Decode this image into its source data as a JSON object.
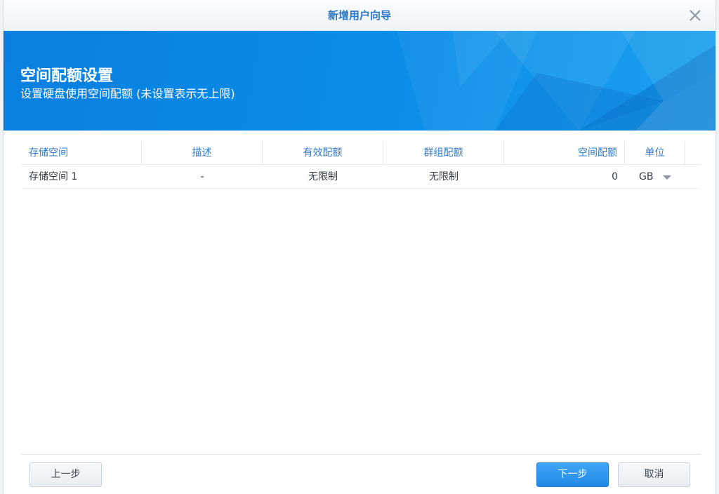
{
  "dialog": {
    "title": "新增用户向导"
  },
  "banner": {
    "title": "空间配额设置",
    "subtitle": "设置硬盘使用空间配额 (未设置表示无上限)"
  },
  "table": {
    "headers": [
      "存储空间",
      "描述",
      "有效配额",
      "群组配额",
      "空间配额",
      "单位"
    ],
    "rows": [
      [
        "存储空间 1",
        "-",
        "无限制",
        "无限制",
        "0",
        "GB"
      ]
    ]
  },
  "buttons": {
    "prev": "上一步",
    "next": "下一步",
    "cancel": "取消"
  },
  "icons": {
    "close": "close-icon",
    "dropdown": "chevron-down-icon"
  },
  "colors": {
    "accent": "#2b78c8",
    "banner": "#0a8ee8",
    "primary_button": "#1f8ae6"
  }
}
